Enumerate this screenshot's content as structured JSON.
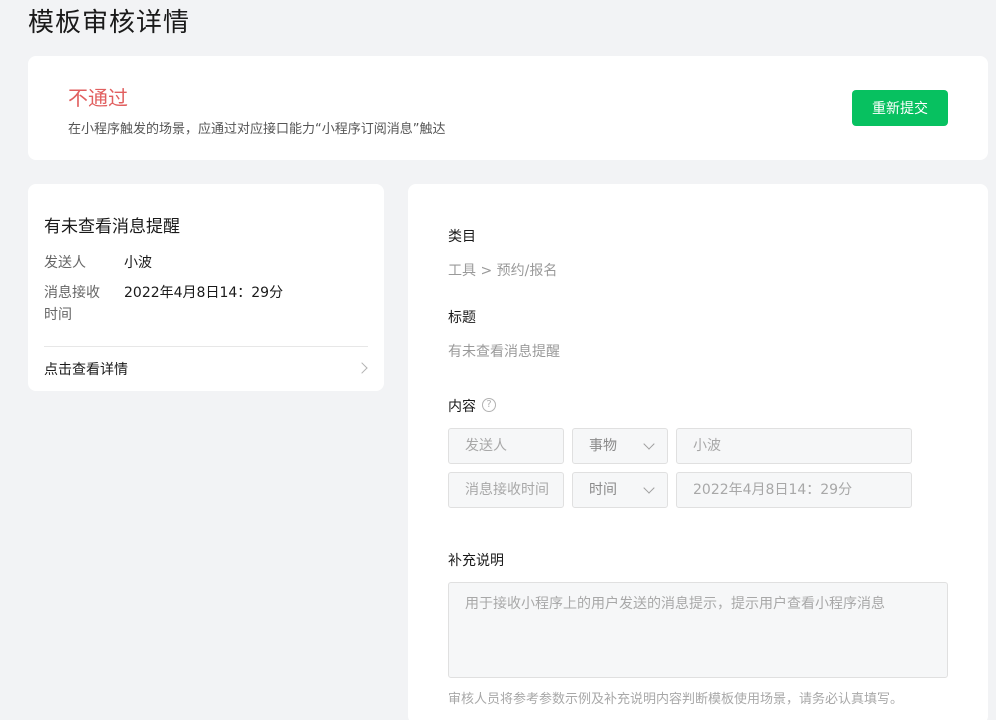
{
  "page": {
    "title": "模板审核详情"
  },
  "status": {
    "text": "不通过",
    "description": "在小程序触发的场景，应通过对应接口能力“小程序订阅消息”触达",
    "resubmit_label": "重新提交",
    "colors": {
      "status": "#e15f5f",
      "button": "#07c160"
    }
  },
  "preview": {
    "title": "有未查看消息提醒",
    "sender_label": "发送人",
    "sender_value": "小波",
    "time_label": "消息接收时间",
    "time_value": "2022年4月8日14：29分",
    "detail_link": "点击查看详情"
  },
  "form": {
    "category_label": "类目",
    "category_value": "工具 > 预约/报名",
    "title_label": "标题",
    "title_value": "有未查看消息提醒",
    "content_label": "内容",
    "content_help_icon": "question-circle-icon",
    "rows": [
      {
        "field": "发送人",
        "type": "事物",
        "value": "小波"
      },
      {
        "field": "消息接收时间",
        "type": "时间",
        "value": "2022年4月8日14：29分"
      }
    ],
    "note_label": "补充说明",
    "note_value": "用于接收小程序上的用户发送的消息提示，提示用户查看小程序消息",
    "note_hint": "审核人员将参考参数示例及补充说明内容判断模板使用场景，请务必认真填写。"
  }
}
